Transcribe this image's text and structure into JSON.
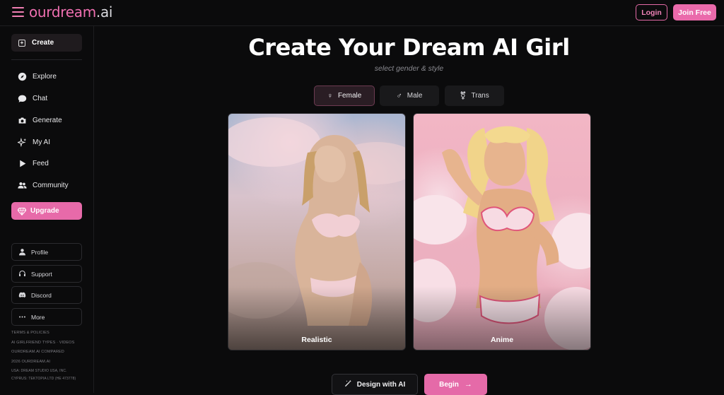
{
  "header": {
    "logo_brand": "ourdream",
    "logo_tld": ".ai",
    "login_label": "Login",
    "join_label": "Join Free"
  },
  "sidebar": {
    "create_label": "Create",
    "items": [
      {
        "label": "Explore",
        "icon": "compass-icon"
      },
      {
        "label": "Chat",
        "icon": "chat-bubble-icon"
      },
      {
        "label": "Generate",
        "icon": "camera-icon"
      },
      {
        "label": "My AI",
        "icon": "sparkles-icon"
      },
      {
        "label": "Feed",
        "icon": "play-icon"
      },
      {
        "label": "Community",
        "icon": "users-icon"
      }
    ],
    "upgrade_label": "Upgrade",
    "secondary": [
      {
        "label": "Profile",
        "icon": "person-icon"
      },
      {
        "label": "Support",
        "icon": "headset-icon"
      },
      {
        "label": "Discord",
        "icon": "discord-icon"
      },
      {
        "label": "More",
        "icon": "ellipsis-icon"
      }
    ],
    "footer": {
      "terms": "TERMS & POLICIES",
      "types": "AI GIRLFRIEND TYPES",
      "sep": "·",
      "videos": "VIDEOS",
      "compared": "OURDREAM.AI COMPARED",
      "copyright": "2026 OURDREAM.AI",
      "usa": "USA: DREAM STUDIO USA, INC.",
      "cyprus": "CYPRUS: TEKTOPIA LTD (HE 473778)"
    }
  },
  "main": {
    "title": "Create Your Dream AI Girl",
    "subtitle": "select gender & style",
    "genders": [
      {
        "label": "Female",
        "icon": "♀",
        "active": true
      },
      {
        "label": "Male",
        "icon": "♂",
        "active": false
      },
      {
        "label": "Trans",
        "icon": "⚧",
        "active": false
      }
    ],
    "styles": [
      {
        "label": "Realistic"
      },
      {
        "label": "Anime"
      }
    ],
    "design_label": "Design with AI",
    "begin_label": "Begin"
  },
  "colors": {
    "accent": "#e96aaa",
    "background": "#0b0b0c"
  }
}
